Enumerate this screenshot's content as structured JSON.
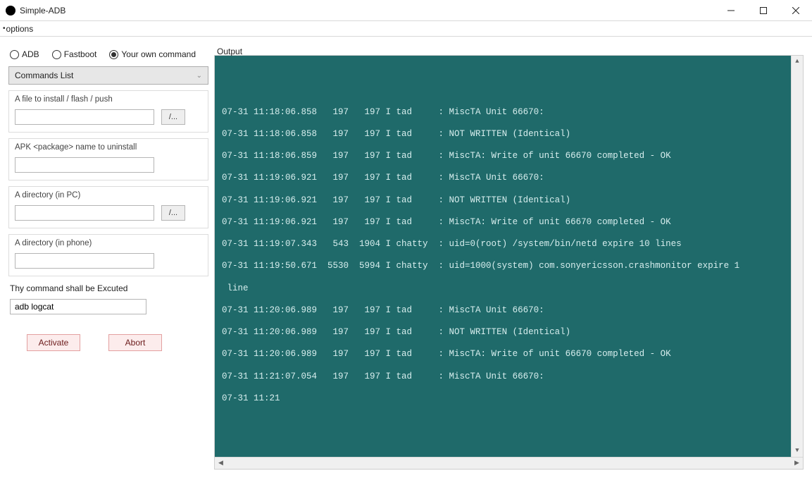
{
  "window": {
    "title": "Simple-ADB"
  },
  "menubar": {
    "options": "options"
  },
  "radios": {
    "adb": "ADB",
    "fastboot": "Fastboot",
    "own": "Your own command",
    "selected": "own"
  },
  "combo": {
    "label": "Commands List"
  },
  "groups": {
    "install": {
      "label": "A file to install / flash / push",
      "value": "",
      "browse": "/..."
    },
    "uninstall": {
      "label": "APK <package> name to uninstall",
      "value": ""
    },
    "dir_pc": {
      "label": "A directory (in PC)",
      "value": "",
      "browse": "/..."
    },
    "dir_phone": {
      "label": "A directory (in phone)",
      "value": ""
    }
  },
  "command": {
    "label": "Thy command shall be Excuted",
    "value": "adb logcat"
  },
  "buttons": {
    "activate": "Activate",
    "abort": "Abort"
  },
  "output": {
    "label": "Output",
    "lines": [
      "07-31 11:18:06.858   197   197 I tad     : MiscTA Unit 66670:",
      "07-31 11:18:06.858   197   197 I tad     : NOT WRITTEN (Identical)",
      "07-31 11:18:06.859   197   197 I tad     : MiscTA: Write of unit 66670 completed - OK",
      "07-31 11:19:06.921   197   197 I tad     : MiscTA Unit 66670:",
      "07-31 11:19:06.921   197   197 I tad     : NOT WRITTEN (Identical)",
      "07-31 11:19:06.921   197   197 I tad     : MiscTA: Write of unit 66670 completed - OK",
      "07-31 11:19:07.343   543  1904 I chatty  : uid=0(root) /system/bin/netd expire 10 lines",
      "07-31 11:19:50.671  5530  5994 I chatty  : uid=1000(system) com.sonyericsson.crashmonitor expire 1\n line",
      "07-31 11:20:06.989   197   197 I tad     : MiscTA Unit 66670:",
      "07-31 11:20:06.989   197   197 I tad     : NOT WRITTEN (Identical)",
      "07-31 11:20:06.989   197   197 I tad     : MiscTA: Write of unit 66670 completed - OK",
      "07-31 11:21:07.054   197   197 I tad     : MiscTA Unit 66670:",
      "07-31 11:21"
    ]
  }
}
